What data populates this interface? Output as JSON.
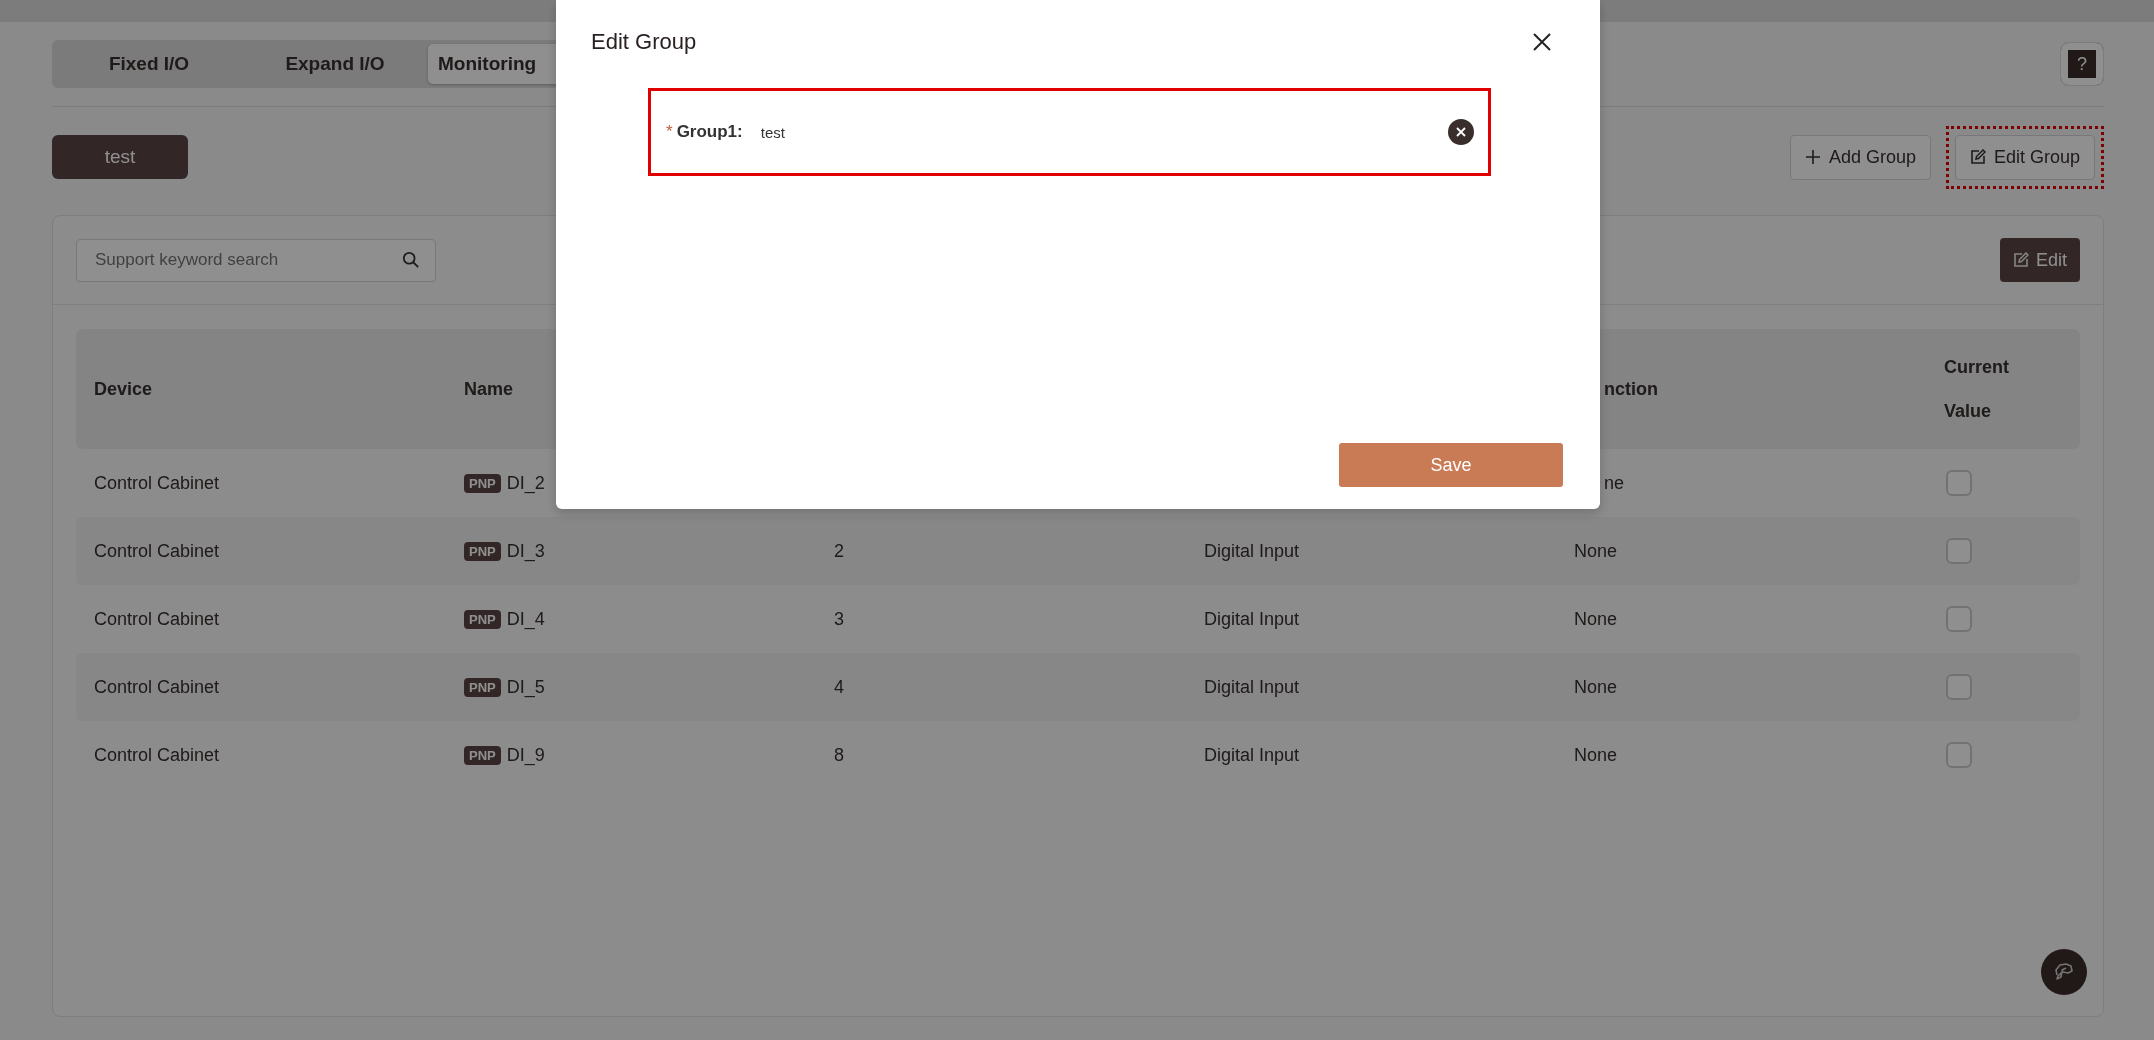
{
  "tabs": [
    {
      "label": "Fixed I/O",
      "selected": false,
      "cut_off": false
    },
    {
      "label": "Expand I/O",
      "selected": false,
      "cut_off": false
    },
    {
      "label": "Monitoring",
      "selected": true,
      "cut_off": true
    }
  ],
  "help_button": {
    "label": "?"
  },
  "groups": [
    {
      "label": "test",
      "selected": true
    }
  ],
  "group_actions": [
    {
      "kind": "add",
      "label": "Add Group",
      "highlighted": false
    },
    {
      "kind": "edit",
      "label": "Edit Group",
      "highlighted": true
    }
  ],
  "search": {
    "placeholder": "Support keyword search"
  },
  "edit_button": {
    "label": "Edit"
  },
  "table": {
    "header": {
      "device": "Device",
      "name": "Name",
      "column_5": "nction",
      "current_value": "Current Value"
    },
    "rows": [
      {
        "device": "Control Cabinet",
        "badge": "PNP",
        "name": "DI_2",
        "column_5": "ne",
        "column_5_cut_off": true,
        "checked": false
      },
      {
        "device": "Control Cabinet",
        "badge": "PNP",
        "name": "DI_3",
        "column_3": "2",
        "column_4": "Digital Input",
        "column_5": "None",
        "checked": false
      },
      {
        "device": "Control Cabinet",
        "badge": "PNP",
        "name": "DI_4",
        "column_3": "3",
        "column_4": "Digital Input",
        "column_5": "None",
        "checked": false
      },
      {
        "device": "Control Cabinet",
        "badge": "PNP",
        "name": "DI_5",
        "column_3": "4",
        "column_4": "Digital Input",
        "column_5": "None",
        "checked": false
      },
      {
        "device": "Control Cabinet",
        "badge": "PNP",
        "name": "DI_9",
        "column_3": "8",
        "column_4": "Digital Input",
        "column_5": "None",
        "checked": false
      }
    ]
  },
  "dialog": {
    "title": "Edit Group",
    "highlighted": true,
    "field": {
      "required_mark": "*",
      "label": "Group1:",
      "value": "test"
    },
    "save_button": {
      "label": "Save"
    }
  }
}
